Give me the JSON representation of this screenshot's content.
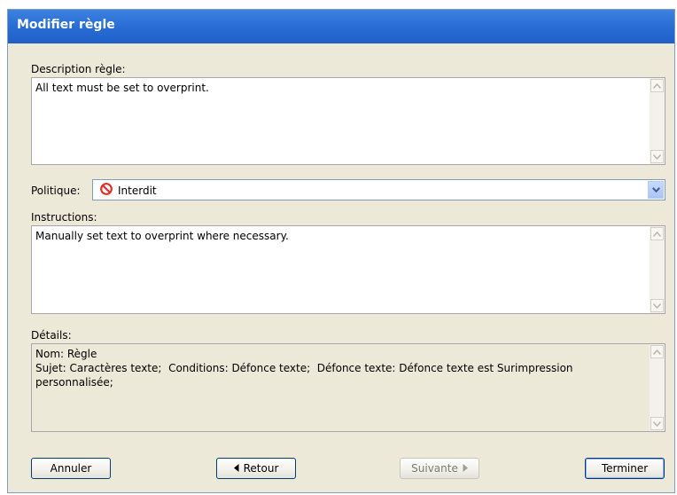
{
  "window": {
    "title": "Modifier règle"
  },
  "description": {
    "label": "Description règle:",
    "value": "All text must be set to overprint."
  },
  "policy": {
    "label": "Politique:",
    "selected": "Interdit",
    "icon": "prohibited-icon"
  },
  "instructions": {
    "label": "Instructions:",
    "value": "Manually set text to overprint where necessary."
  },
  "details": {
    "label": "Détails:",
    "value": "Nom: Règle\nSujet: Caractères texte;  Conditions: Défonce texte;  Défonce texte: Défonce texte est Surimpression\npersonnalisée;"
  },
  "buttons": {
    "cancel": "Annuler",
    "back": "Retour",
    "next": "Suivante",
    "finish": "Terminer"
  },
  "colors": {
    "title_bar": "#2a6fd6",
    "dialog_bg": "#ece9d8",
    "prohibited": "#e0302a"
  }
}
